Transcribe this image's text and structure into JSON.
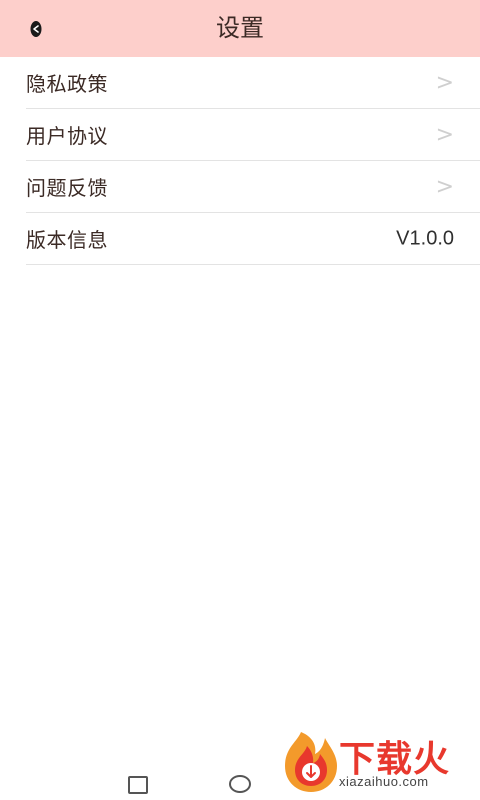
{
  "header": {
    "title": "设置",
    "back_icon": "back-arrow-icon",
    "background": "#fdcfcb"
  },
  "settings": {
    "items": [
      {
        "label": "隐私政策",
        "chevron": ">"
      },
      {
        "label": "用户协议",
        "chevron": ">"
      },
      {
        "label": "问题反馈",
        "chevron": ">"
      },
      {
        "label": "版本信息",
        "value": "V1.0.0"
      }
    ]
  },
  "navbar": {
    "recents_icon": "square-icon",
    "home_icon": "circle-icon"
  },
  "watermark": {
    "text": "下载火",
    "site": "xiazaihuo.com",
    "color": "#e8382d"
  }
}
